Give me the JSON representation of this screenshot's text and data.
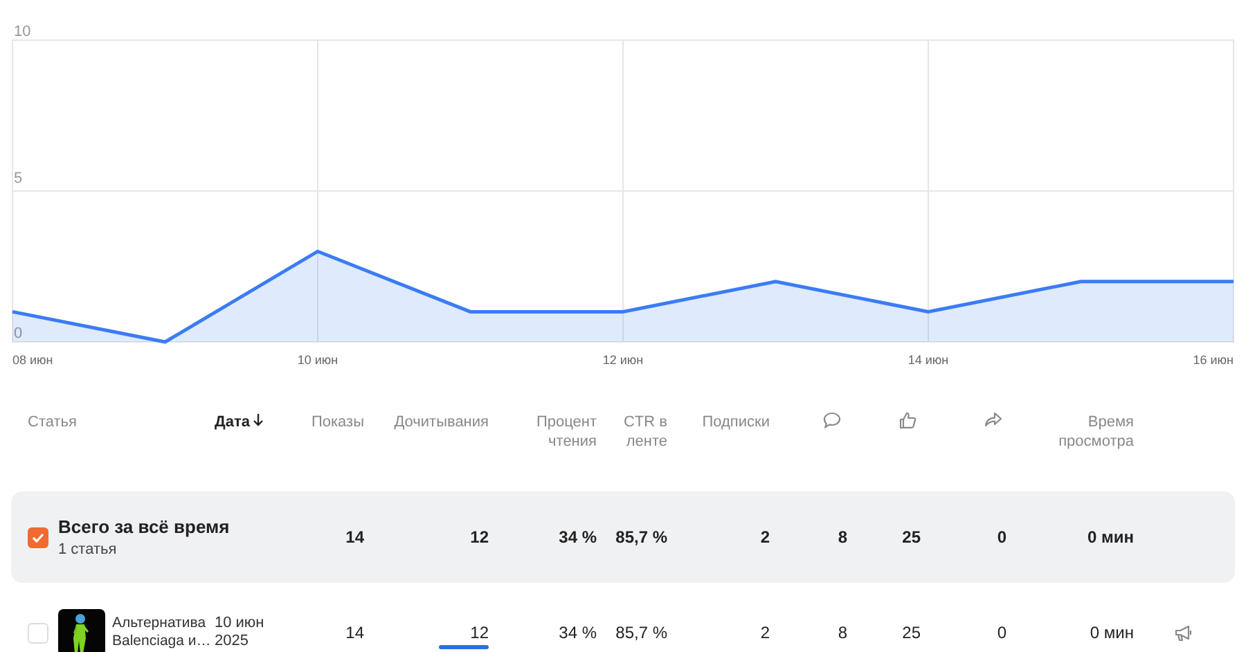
{
  "chart": {
    "chart_data": {
      "type": "area",
      "categories": [
        "08 июн",
        null,
        "10 июн",
        null,
        "12 июн",
        null,
        "14 июн",
        null,
        "16 июн"
      ],
      "series": [
        {
          "color": "#3b7cf5",
          "values": [
            1,
            0,
            3,
            1,
            1,
            2,
            1,
            2,
            2
          ]
        }
      ],
      "ylim": [
        0,
        10
      ],
      "yticks": [
        0,
        5,
        10
      ],
      "grid": true
    }
  },
  "table": {
    "columns": [
      {
        "kind": "text",
        "label": "Статья"
      },
      {
        "kind": "sort",
        "label": "Дата",
        "sorted": true
      },
      {
        "kind": "text",
        "label": "Показы"
      },
      {
        "kind": "text",
        "label": "Дочитывания"
      },
      {
        "kind": "text",
        "label": "Процент чтения"
      },
      {
        "kind": "text",
        "label": "CTR в ленте"
      },
      {
        "kind": "text",
        "label": "Подписки"
      },
      {
        "kind": "comment-icon"
      },
      {
        "kind": "like-icon"
      },
      {
        "kind": "share-icon"
      },
      {
        "kind": "text",
        "label": "Время просмотра"
      }
    ],
    "summary": {
      "checked": true,
      "title": "Всего за всё время",
      "subtitle": "1 статья",
      "values": [
        "14",
        "12",
        "34 %",
        "85,7 %",
        "2",
        "8",
        "25",
        "0",
        "0 мин"
      ]
    },
    "rows": [
      {
        "checked": false,
        "title": "Альтернатива Balenciaga и…",
        "date": "10 июн 2025",
        "values": [
          "14",
          "12",
          "34 %",
          "85,7 %",
          "2",
          "8",
          "25",
          "0",
          "0 мин"
        ],
        "underlined": true,
        "promote": true
      }
    ]
  }
}
